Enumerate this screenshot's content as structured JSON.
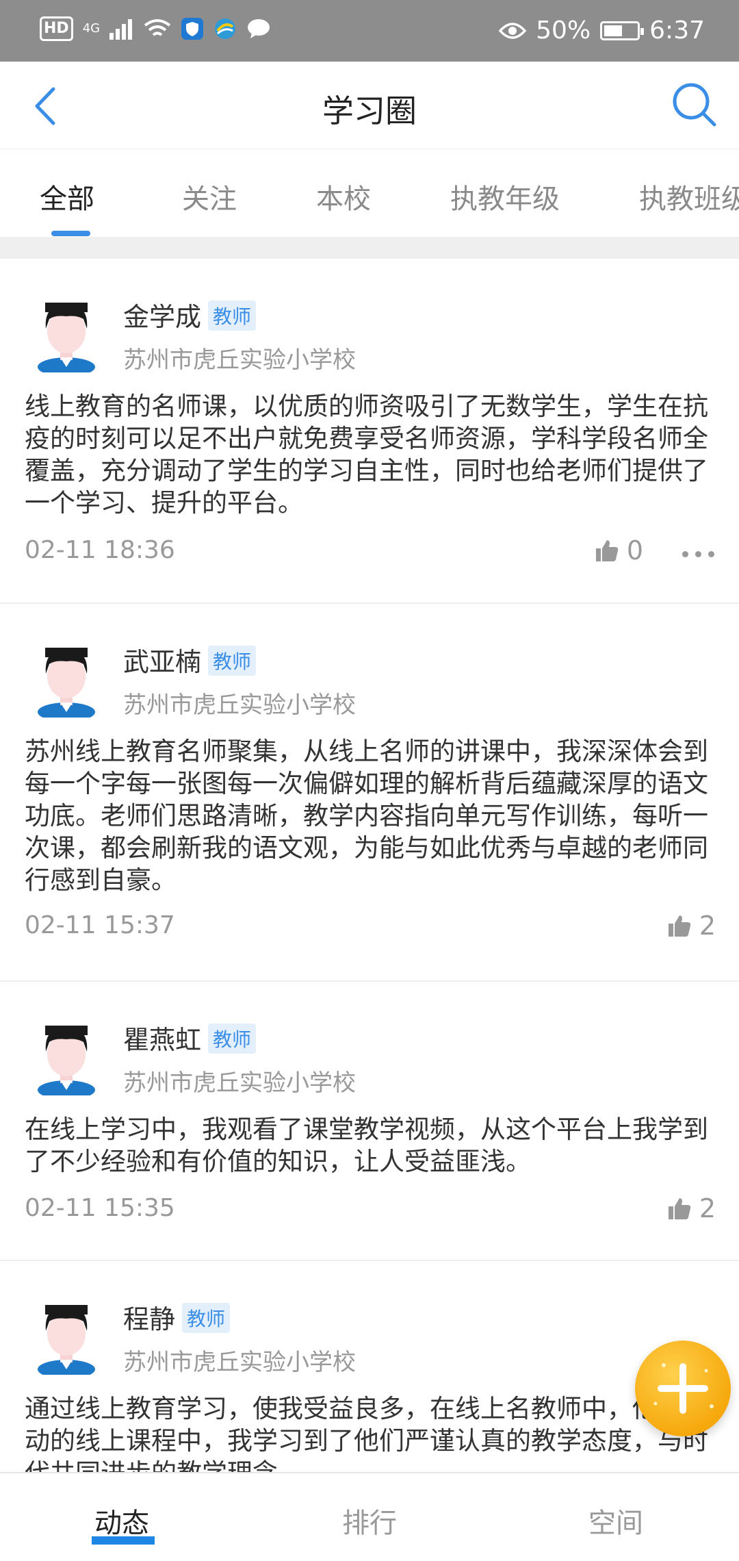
{
  "status_bar": {
    "hd": "HD",
    "network": "4G",
    "battery_percent": "50%",
    "battery_level": 0.5,
    "time": "6:37"
  },
  "header": {
    "title": "学习圈",
    "back_icon": "chevron-left-icon",
    "search_icon": "search-icon"
  },
  "tabs": [
    {
      "label": "全部",
      "active": true
    },
    {
      "label": "关注",
      "active": false
    },
    {
      "label": "本校",
      "active": false
    },
    {
      "label": "执教年级",
      "active": false
    },
    {
      "label": "执教班级",
      "active": false
    }
  ],
  "posts": [
    {
      "author": "金学成",
      "role": "教师",
      "school": "苏州市虎丘实验小学校",
      "content": "线上教育的名师课，以优质的师资吸引了无数学生，学生在抗疫的时刻可以足不出户就免费享受名师资源，学科学段名师全覆盖，充分调动了学生的学习自主性，同时也给老师们提供了一个学习、提升的平台。",
      "time": "02-11 18:36",
      "likes": "0"
    },
    {
      "author": "武亚楠",
      "role": "教师",
      "school": "苏州市虎丘实验小学校",
      "content": "苏州线上教育名师聚集，从线上名师的讲课中，我深深体会到每一个字每一张图每一次偏僻如理的解析背后蕴藏深厚的语文功底。老师们思路清晰，教学内容指向单元写作训练，每听一次课，都会刷新我的语文观，为能与如此优秀与卓越的老师同行感到自豪。",
      "time": "02-11 15:37",
      "likes": "2"
    },
    {
      "author": "瞿燕虹",
      "role": "教师",
      "school": "苏州市虎丘实验小学校",
      "content": "在线上学习中，我观看了课堂教学视频，从这个平台上我学到了不少经验和有价值的知识，让人受益匪浅。",
      "time": "02-11 15:35",
      "likes": "2"
    },
    {
      "author": "程静",
      "role": "教师",
      "school": "苏州市虎丘实验小学校",
      "content": "通过线上教育学习，使我受益良多，在线上名教师中，他们生动的线上课程中，我学习到了他们严谨认真的教学态度，与时代共同进步的教学理念。",
      "time": "",
      "likes": ""
    }
  ],
  "bottom_nav": [
    {
      "label": "动态",
      "active": true
    },
    {
      "label": "排行",
      "active": false
    },
    {
      "label": "空间",
      "active": false
    }
  ],
  "colors": {
    "accent": "#3a8ee6",
    "fab": "#f6a90d",
    "status_bar": "#8d8d8d"
  }
}
